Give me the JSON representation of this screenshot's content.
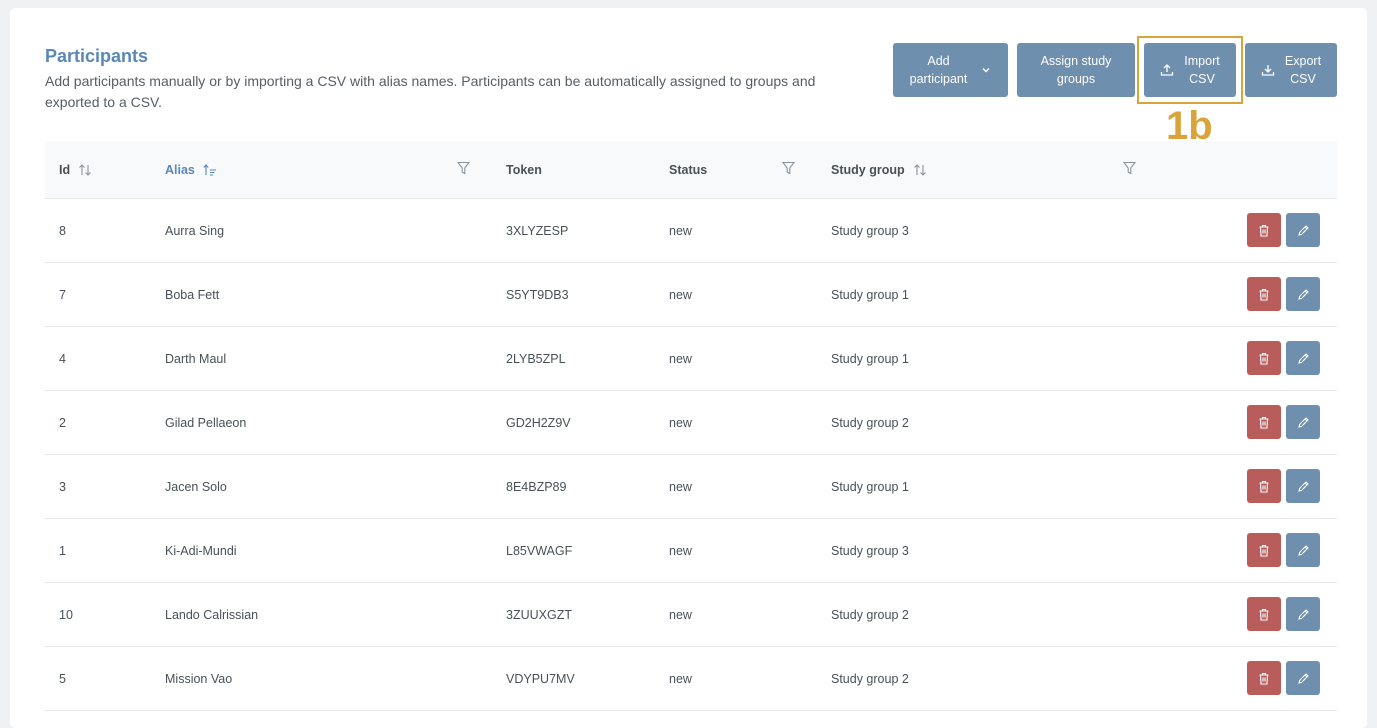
{
  "header": {
    "title": "Participants",
    "subtitle": "Add participants manually or by importing a CSV with alias names. Participants can be automatically assigned to groups and exported to a CSV."
  },
  "toolbar": {
    "add_label": "Add\nparticipant",
    "assign_label": "Assign study\ngroups",
    "import_label": "Import\nCSV",
    "export_label": "Export\nCSV"
  },
  "annotation": {
    "label": "1b",
    "color": "#d9a43a"
  },
  "table": {
    "columns": {
      "id": "Id",
      "alias": "Alias",
      "token": "Token",
      "status": "Status",
      "study_group": "Study group"
    },
    "rows": [
      {
        "id": "8",
        "alias": "Aurra Sing",
        "token": "3XLYZESP",
        "status": "new",
        "group": "Study group 3"
      },
      {
        "id": "7",
        "alias": "Boba Fett",
        "token": "S5YT9DB3",
        "status": "new",
        "group": "Study group 1"
      },
      {
        "id": "4",
        "alias": "Darth Maul",
        "token": "2LYB5ZPL",
        "status": "new",
        "group": "Study group 1"
      },
      {
        "id": "2",
        "alias": "Gilad Pellaeon",
        "token": "GD2H2Z9V",
        "status": "new",
        "group": "Study group 2"
      },
      {
        "id": "3",
        "alias": "Jacen Solo",
        "token": "8E4BZP89",
        "status": "new",
        "group": "Study group 1"
      },
      {
        "id": "1",
        "alias": "Ki-Adi-Mundi",
        "token": "L85VWAGF",
        "status": "new",
        "group": "Study group 3"
      },
      {
        "id": "10",
        "alias": "Lando Calrissian",
        "token": "3ZUUXGZT",
        "status": "new",
        "group": "Study group 2"
      },
      {
        "id": "5",
        "alias": "Mission Vao",
        "token": "VDYPU7MV",
        "status": "new",
        "group": "Study group 2"
      }
    ]
  },
  "colors": {
    "accent": "#5b87b5",
    "button": "#6e8fae",
    "delete": "#b85c5c",
    "highlight": "#d9a43a"
  },
  "icons": {
    "sort": "sort-icon",
    "sort_active": "sort-alpha-icon",
    "filter": "filter-icon",
    "delete": "trash-icon",
    "edit": "pencil-icon",
    "upload": "upload-icon",
    "download": "download-icon",
    "dropdown": "chevron-down-icon"
  }
}
